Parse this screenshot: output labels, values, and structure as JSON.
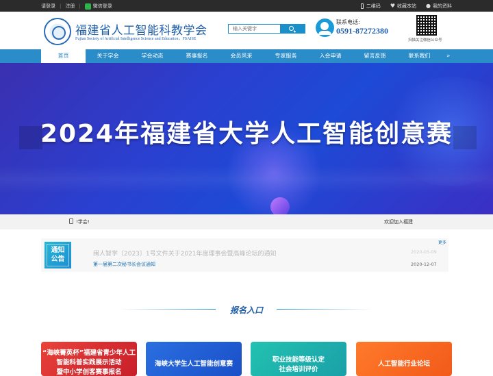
{
  "topbar": {
    "login": "请登录",
    "register": "注册",
    "wechat_login": "微信登录",
    "qrcode": "二维码",
    "bookmark": "收藏本站",
    "profile": "我的资料"
  },
  "header": {
    "title": "福建省人工智能科教学会",
    "subtitle": "Fujian Society of Artificial Intelligence Science and Education，FSAISE",
    "search_placeholder": "输入关键字",
    "hotline_label": "联系电话:",
    "hotline_number": "0591-87272380",
    "qr_caption": "扫描关注微信公众号"
  },
  "nav": {
    "items": [
      {
        "label": "首页"
      },
      {
        "label": "关于学会"
      },
      {
        "label": "学会动态"
      },
      {
        "label": "赛事报名"
      },
      {
        "label": "会员风采"
      },
      {
        "label": "专家服务"
      },
      {
        "label": "入会申请"
      },
      {
        "label": "留言反馈"
      },
      {
        "label": "联系我们"
      }
    ],
    "more": "»"
  },
  "banner": {
    "title": "2024年福建省大学人工智能创意赛"
  },
  "strip": {
    "scroll_text": "!学会!",
    "welcome": "欢迎加入福建"
  },
  "notice": {
    "badge_line1": "通知",
    "badge_line2": "公告",
    "more": "更多",
    "items": [
      {
        "title": "闽人智学〔2023〕1号文件关于2021年度理事会暨高峰论坛的通知",
        "date": "2020-05-09"
      },
      {
        "title": "第一届第二次秘书长会议通知",
        "date": "2020-12-07"
      }
    ]
  },
  "section": {
    "title": "报名入口"
  },
  "cards": [
    {
      "lines": [
        "“海峡菁英杯”福建省青少年人工",
        "智能科普实践展示活动",
        "暨中小学创客赛事报名"
      ]
    },
    {
      "lines": [
        "海峡大学生人工智能创意赛"
      ]
    },
    {
      "lines": [
        "职业技能等级认定",
        "社会培训评价"
      ]
    },
    {
      "lines": [
        "人工智能行业论坛"
      ]
    }
  ]
}
